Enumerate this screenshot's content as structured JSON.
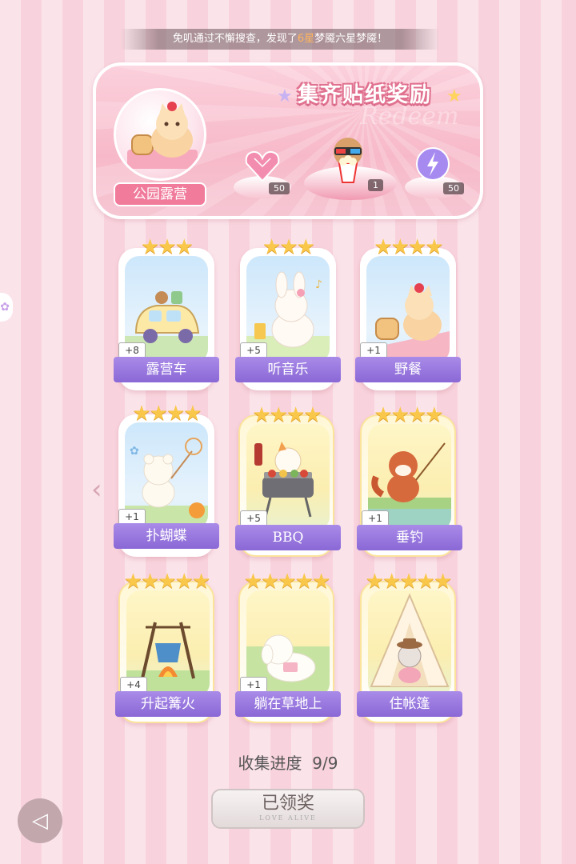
{
  "ticker": {
    "prefix": "免叽通过不懈搜查，发现了",
    "highlight": "6星",
    "suffix": "梦魇六星梦魇！"
  },
  "banner": {
    "title": "集齐贴纸奖励",
    "watermark": "Redeem",
    "place_label": "公园露营",
    "rewards": [
      {
        "icon": "pink-heart-gem-icon",
        "count": "50"
      },
      {
        "icon": "popcorn-bear-icon",
        "count": "1"
      },
      {
        "icon": "purple-lightning-orb-icon",
        "count": "50"
      }
    ]
  },
  "stickers": [
    {
      "name": "露营车",
      "plus": "+8",
      "stars": "★★★",
      "tone": "blue"
    },
    {
      "name": "听音乐",
      "plus": "+5",
      "stars": "★★★",
      "tone": "blue"
    },
    {
      "name": "野餐",
      "plus": "+1",
      "stars": "★★★★",
      "tone": "blue"
    },
    {
      "name": "扑蝴蝶",
      "plus": "+1",
      "stars": "★★★★",
      "tone": "blue"
    },
    {
      "name": "BBQ",
      "plus": "+5",
      "stars": "★★★★",
      "tone": "gold"
    },
    {
      "name": "垂钓",
      "plus": "+1",
      "stars": "★★★★",
      "tone": "gold"
    },
    {
      "name": "升起篝火",
      "plus": "+4",
      "stars": "★★★★★",
      "tone": "gold"
    },
    {
      "name": "躺在草地上",
      "plus": "+1",
      "stars": "★★★★★",
      "tone": "gold"
    },
    {
      "name": "住帐篷",
      "plus": "",
      "stars": "★★★★★",
      "tone": "gold"
    }
  ],
  "progress": {
    "label": "收集进度",
    "value": "9/9"
  },
  "claim_button": {
    "label": "已领奖",
    "sub": "LOVE ALIVE"
  },
  "colors": {
    "accent_pink": "#f07b9b",
    "name_bar_purple": "#9575de",
    "star_gold": "#f9c84a"
  }
}
